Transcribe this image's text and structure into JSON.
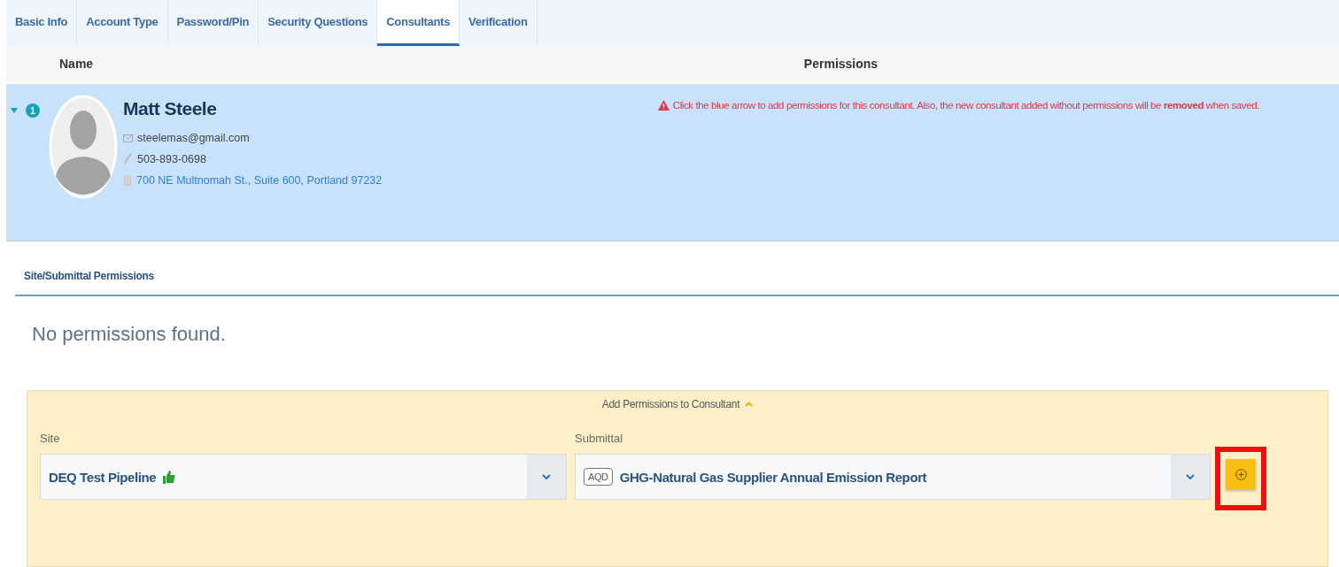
{
  "tabs": [
    {
      "label": "Basic Info",
      "selected": false
    },
    {
      "label": "Account Type",
      "selected": false
    },
    {
      "label": "Password/Pin",
      "selected": false
    },
    {
      "label": "Security Questions",
      "selected": false
    },
    {
      "label": "Consultants",
      "selected": true
    },
    {
      "label": "Verification",
      "selected": false
    }
  ],
  "table": {
    "columns": [
      "Name",
      "Permissions"
    ]
  },
  "consultant": {
    "expanded": true,
    "index": "1",
    "name": "Matt Steele",
    "email": "steelemas@gmail.com",
    "phone": "503-893-0698",
    "address": "700 NE Multnomah St., Suite 600, Portland 97232",
    "warning": "Click the blue arrow to add permissions for this consultant. Also, the new consultant added without permissions will be **removed** when saved."
  },
  "permissions": {
    "title": "Site/Submittal Permissions",
    "empty_message": "No permissions found."
  },
  "add_panel": {
    "title": "Add Permissions to Consultant",
    "expanded": true,
    "site": {
      "label": "Site",
      "value": "DEQ Test Pipeline"
    },
    "submittal": {
      "label": "Submittal",
      "tag": "AQD",
      "value": "GHG-Natural Gas Supplier Annual Emission Report"
    },
    "add_button": {
      "highlighted": true
    }
  }
}
